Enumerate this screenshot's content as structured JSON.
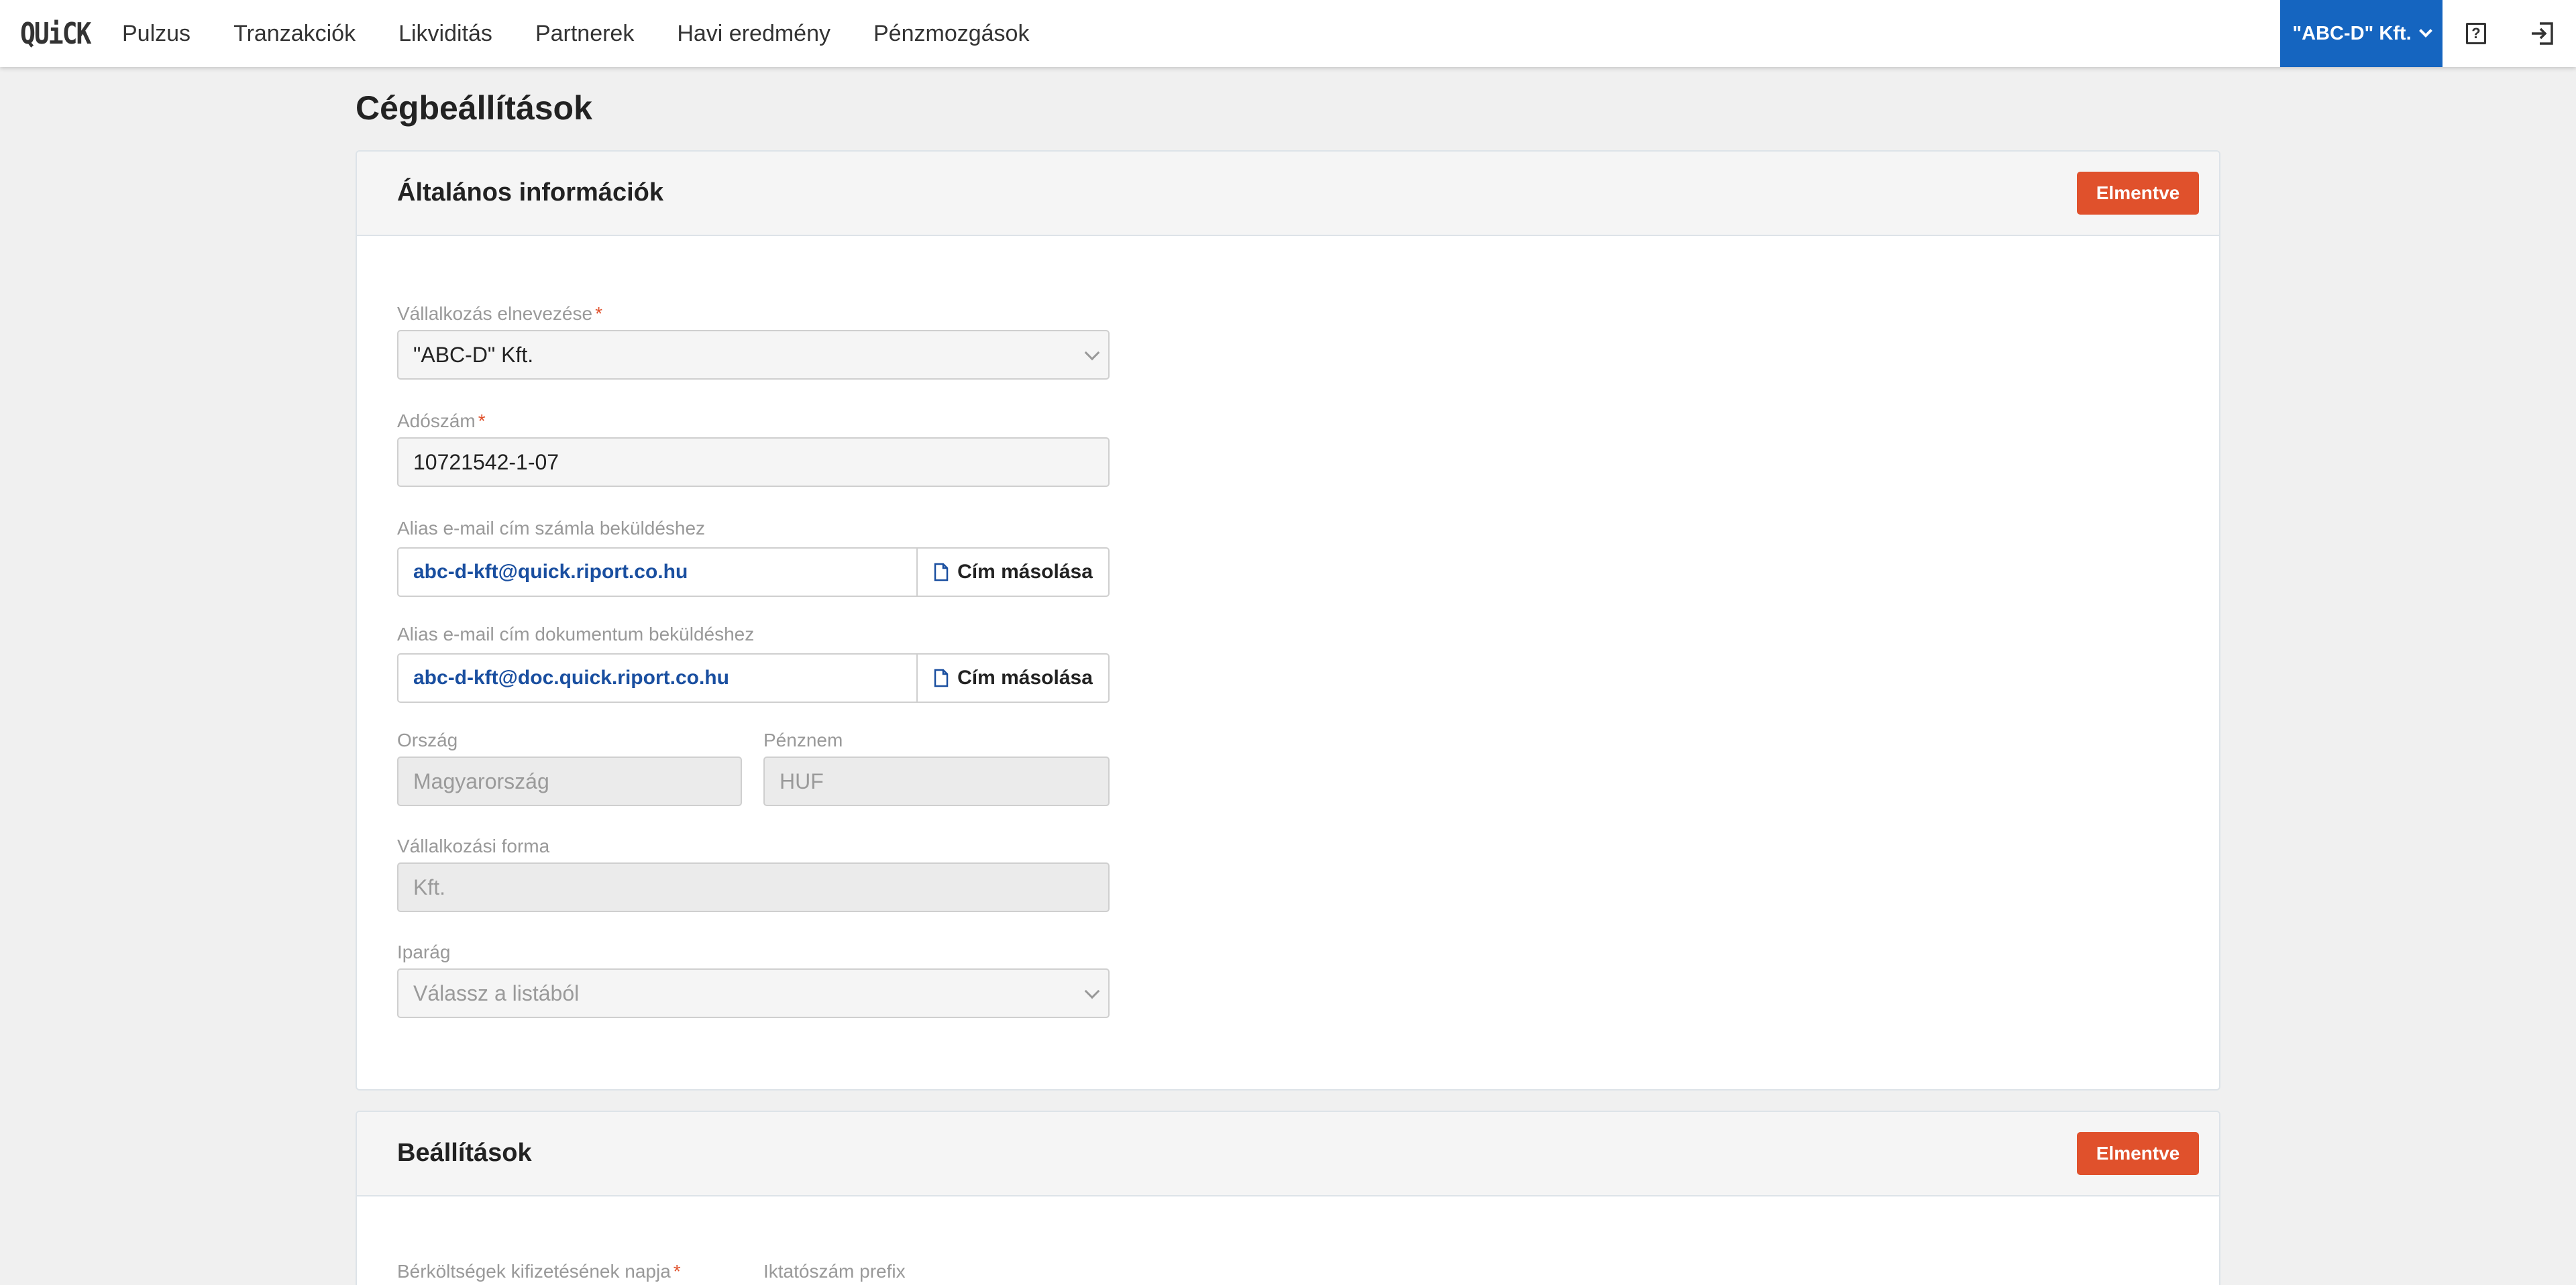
{
  "header": {
    "logo": "QUiCK",
    "nav": [
      "Pulzus",
      "Tranzakciók",
      "Likviditás",
      "Partnerek",
      "Havi eredmény",
      "Pénzmozgások"
    ],
    "company_selector": "\"ABC-D\" Kft.",
    "help_icon": "question-square-icon",
    "logout_icon": "logout-icon"
  },
  "page": {
    "title": "Cégbeállítások"
  },
  "general": {
    "title": "Általános információk",
    "save_label": "Elmentve",
    "company_name": {
      "label": "Vállalkozás elnevezése",
      "required": "*",
      "value": "\"ABC-D\" Kft."
    },
    "tax_number": {
      "label": "Adószám",
      "required": "*",
      "value": "10721542-1-07"
    },
    "invoice_alias": {
      "label": "Alias e-mail cím számla beküldéshez",
      "value": "abc-d-kft@quick.riport.co.hu",
      "copy_label": "Cím másolása"
    },
    "document_alias": {
      "label": "Alias e-mail cím dokumentum beküldéshez",
      "value": "abc-d-kft@doc.quick.riport.co.hu",
      "copy_label": "Cím másolása"
    },
    "country": {
      "label": "Ország",
      "value": "Magyarország"
    },
    "currency": {
      "label": "Pénznem",
      "value": "HUF"
    },
    "business_form": {
      "label": "Vállalkozási forma",
      "value": "Kft."
    },
    "industry": {
      "label": "Iparág",
      "placeholder": "Válassz a listából"
    }
  },
  "settings": {
    "title": "Beállítások",
    "save_label": "Elmentve",
    "salary_day": {
      "label": "Bérköltségek kifizetésének napja",
      "required": "*"
    },
    "filing_prefix": {
      "label": "Iktatószám prefix"
    }
  },
  "colors": {
    "accent_blue": "#1565c0",
    "save_orange": "#e0512c",
    "alias_text": "#1a4fa0"
  }
}
